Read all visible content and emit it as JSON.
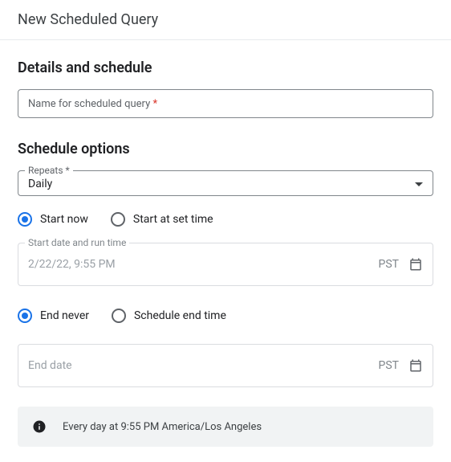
{
  "header": {
    "title": "New Scheduled Query"
  },
  "details": {
    "title": "Details and schedule",
    "name_placeholder": "Name for scheduled query",
    "required": "*"
  },
  "schedule": {
    "title": "Schedule options",
    "repeats_label": "Repeats *",
    "repeats_value": "Daily",
    "start_now_label": "Start now",
    "start_at_label": "Start at set time",
    "start_date_label": "Start date and run time",
    "start_date_value": "2/22/22, 9:55 PM",
    "tz": "PST",
    "end_never_label": "End never",
    "end_time_label": "Schedule end time",
    "end_date_placeholder": "End date"
  },
  "summary": {
    "text": "Every day at 9:55 PM America/Los Angeles"
  }
}
